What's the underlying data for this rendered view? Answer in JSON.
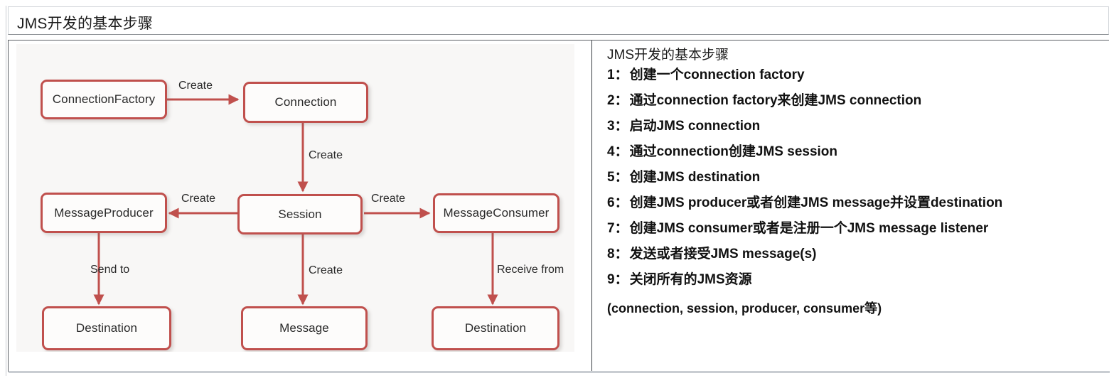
{
  "header": {
    "title": "JMS开发的基本步骤"
  },
  "diagram": {
    "nodes": [
      {
        "id": "connection-factory",
        "label": "ConnectionFactory"
      },
      {
        "id": "connection",
        "label": "Connection"
      },
      {
        "id": "message-producer",
        "label": "MessageProducer"
      },
      {
        "id": "session",
        "label": "Session"
      },
      {
        "id": "message-consumer",
        "label": "MessageConsumer"
      },
      {
        "id": "destination-left",
        "label": "Destination"
      },
      {
        "id": "message",
        "label": "Message"
      },
      {
        "id": "destination-right",
        "label": "Destination"
      }
    ],
    "edges": [
      {
        "id": "cf-to-connection",
        "label": "Create",
        "from": "connection-factory",
        "to": "connection"
      },
      {
        "id": "connection-to-session",
        "label": "Create",
        "from": "connection",
        "to": "session"
      },
      {
        "id": "session-to-producer",
        "label": "Create",
        "from": "session",
        "to": "message-producer"
      },
      {
        "id": "session-to-consumer",
        "label": "Create",
        "from": "session",
        "to": "message-consumer"
      },
      {
        "id": "producer-to-destination",
        "label": "Send to",
        "from": "message-producer",
        "to": "destination-left"
      },
      {
        "id": "session-to-message",
        "label": "Create",
        "from": "session",
        "to": "message"
      },
      {
        "id": "consumer-to-destination",
        "label": "Receive from",
        "from": "message-consumer",
        "to": "destination-right"
      }
    ],
    "colors": {
      "node_border": "#c0504d",
      "node_fill": "#fdfcfb",
      "edge": "#c0504d",
      "panel_background": "#f8f7f6"
    }
  },
  "steps": {
    "heading": "JMS开发的基本步骤",
    "items": [
      {
        "num": "1：",
        "text": "创建一个connection factory"
      },
      {
        "num": "2：",
        "text": "通过connection factory来创建JMS connection"
      },
      {
        "num": "3：",
        "text": "启动JMS connection"
      },
      {
        "num": "4：",
        "text": "通过connection创建JMS session"
      },
      {
        "num": "5：",
        "text": "创建JMS destination"
      },
      {
        "num": "6：",
        "text": "创建JMS producer或者创建JMS message并设置destination"
      },
      {
        "num": "7：",
        "text": "创建JMS consumer或者是注册一个JMS message listener"
      },
      {
        "num": "8：",
        "text": "发送或者接受JMS message(s)"
      },
      {
        "num": "9：",
        "text": "关闭所有的JMS资源"
      }
    ],
    "note": "(connection, session, producer, consumer等)"
  }
}
